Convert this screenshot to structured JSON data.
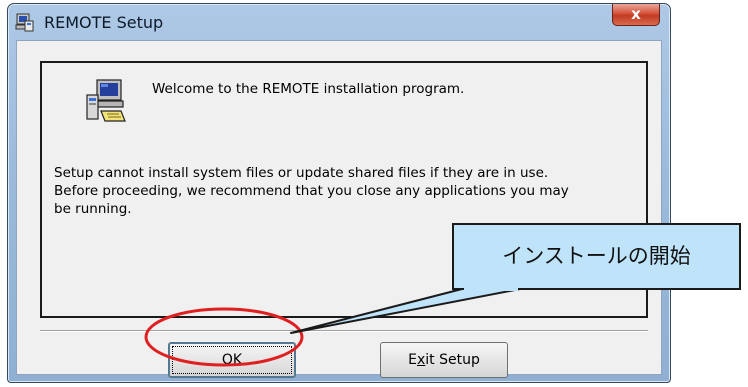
{
  "window": {
    "title": "REMOTE Setup",
    "close_label": "x"
  },
  "dialog": {
    "welcome": "Welcome to the REMOTE installation program.",
    "info_lines": [
      "Setup cannot install system files or update shared files if they are in use.",
      "Before proceeding, we recommend that you close any applications you may",
      "be running."
    ]
  },
  "buttons": {
    "ok_label": "OK",
    "exit_prefix": "E",
    "exit_accel": "x",
    "exit_suffix": "it Setup"
  },
  "annotation": {
    "callout_text": "インストールの開始",
    "highlight_color": "#e02020",
    "callout_color": "#bfe3f8"
  },
  "icons": {
    "app": "setup-computer-icon",
    "setup": "computer-install-icon",
    "close": "close-icon"
  }
}
